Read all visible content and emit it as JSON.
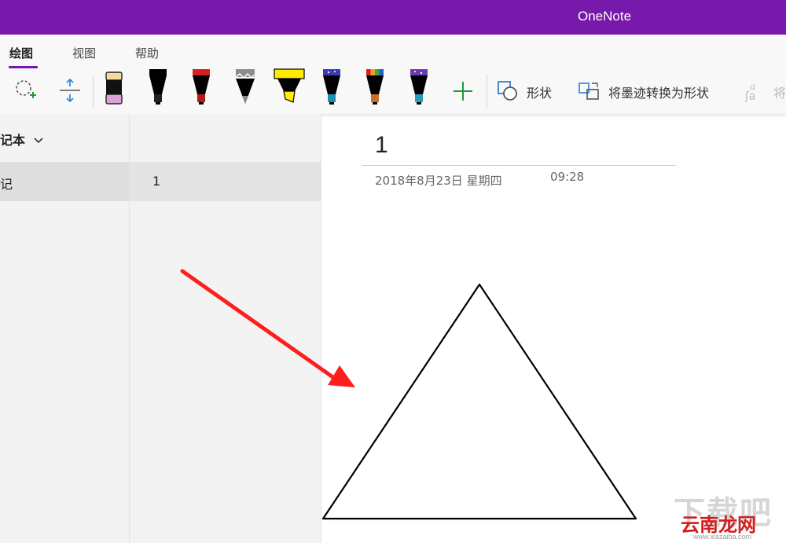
{
  "app": {
    "title": "OneNote"
  },
  "ribbon": {
    "tabs": [
      {
        "label": "绘图",
        "active": true
      },
      {
        "label": "视图",
        "active": false
      },
      {
        "label": "帮助",
        "active": false
      }
    ],
    "tools": {
      "lasso": "lasso-select-icon",
      "space": "add-remove-space-icon",
      "pens": [
        {
          "name": "eraser",
          "color": "#d9a3d9"
        },
        {
          "name": "black-pen",
          "color": "#000000"
        },
        {
          "name": "red-pen",
          "color": "#d71f1f"
        },
        {
          "name": "gray-pencil",
          "color": "#7f7f7f"
        },
        {
          "name": "yellow-highlighter",
          "color": "#ffec00"
        },
        {
          "name": "galaxy-pen",
          "color": "#3b3bb0"
        },
        {
          "name": "rainbow-pen",
          "color": "#3caa3c"
        },
        {
          "name": "galaxy-pen-2",
          "color": "#6a3bb0"
        }
      ],
      "shapes_label": "形状",
      "ink_to_shape_label": "将墨迹转换为形状",
      "ink_to_text_label": "将"
    }
  },
  "sidebar": {
    "notebook_title": "记本",
    "section": "记",
    "page": "1"
  },
  "page": {
    "title": "1",
    "date": "2018年8月23日 星期四",
    "time": "09:28"
  },
  "watermark": {
    "top": "下载吧",
    "brand": "云南龙网",
    "url": "www.xiazaiba.com"
  },
  "colors": {
    "accent": "#7719aa",
    "arrow": "#ff1e1e"
  }
}
